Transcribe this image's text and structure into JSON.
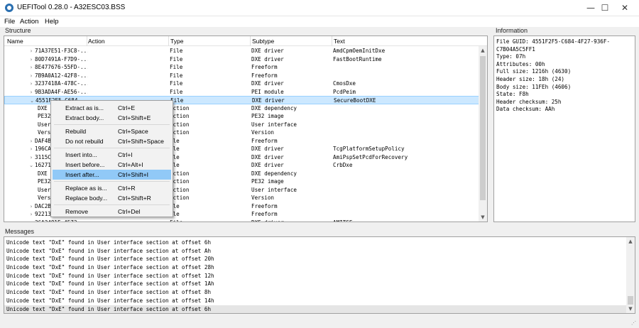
{
  "window": {
    "title": "UEFITool 0.28.0 - A32ESC03.BSS",
    "minimize": "—",
    "maximize": "☐",
    "close": "✕"
  },
  "menu": [
    "File",
    "Action",
    "Help"
  ],
  "structure": {
    "label": "Structure",
    "columns": [
      "Name",
      "Action",
      "Type",
      "Subtype",
      "Text"
    ],
    "rows": [
      {
        "arrow": "›",
        "name": "71A37E51-F3C8-...",
        "type": "File",
        "subtype": "DXE driver",
        "text": "AmdCpmOemInitDxe"
      },
      {
        "arrow": "›",
        "name": "80D7491A-F7D9-...",
        "type": "File",
        "subtype": "DXE driver",
        "text": "FastBootRuntime"
      },
      {
        "arrow": "›",
        "name": "8E477676-55FD-...",
        "type": "File",
        "subtype": "Freeform",
        "text": ""
      },
      {
        "arrow": "›",
        "name": "7B9A0A12-42F8-...",
        "type": "File",
        "subtype": "Freeform",
        "text": ""
      },
      {
        "arrow": "›",
        "name": "3237418A-478C-...",
        "type": "File",
        "subtype": "DXE driver",
        "text": "CmosDxe"
      },
      {
        "arrow": "›",
        "name": "9B3ADA4F-AE56-...",
        "type": "File",
        "subtype": "PEI module",
        "text": "PcdPeim"
      },
      {
        "arrow": "⌄",
        "name": "4551F2F5-C684-...",
        "type": "File",
        "subtype": "DXE driver",
        "text": "SecureBootDXE"
      },
      {
        "arrow": "",
        "name": "DXE",
        "type": "ection",
        "subtype": "DXE dependency",
        "text": ""
      },
      {
        "arrow": "",
        "name": "PE32",
        "type": "ection",
        "subtype": "PE32 image",
        "text": ""
      },
      {
        "arrow": "",
        "name": "User",
        "type": "ection",
        "subtype": "User interface",
        "text": ""
      },
      {
        "arrow": "",
        "name": "Vers",
        "type": "ection",
        "subtype": "Version",
        "text": ""
      },
      {
        "arrow": "›",
        "name": "DAF4B",
        "type": "ile",
        "subtype": "Freeform",
        "text": ""
      },
      {
        "arrow": "›",
        "name": "196CA",
        "type": "ile",
        "subtype": "DXE driver",
        "text": "TcgPlatformSetupPolicy"
      },
      {
        "arrow": "›",
        "name": "3115C",
        "type": "ile",
        "subtype": "DXE driver",
        "text": "AmiPspSetPcdForRecovery"
      },
      {
        "arrow": "⌄",
        "name": "16271",
        "type": "ile",
        "subtype": "DXE driver",
        "text": "CrbDxe"
      },
      {
        "arrow": "",
        "name": "DXE",
        "type": "ection",
        "subtype": "DXE dependency",
        "text": ""
      },
      {
        "arrow": "",
        "name": "PE32",
        "type": "ection",
        "subtype": "PE32 image",
        "text": ""
      },
      {
        "arrow": "",
        "name": "User",
        "type": "ection",
        "subtype": "User interface",
        "text": ""
      },
      {
        "arrow": "",
        "name": "Vers",
        "type": "ection",
        "subtype": "Version",
        "text": ""
      },
      {
        "arrow": "›",
        "name": "DAC2B",
        "type": "ile",
        "subtype": "Freeform",
        "text": ""
      },
      {
        "arrow": "›",
        "name": "92213",
        "type": "ile",
        "subtype": "Freeform",
        "text": ""
      },
      {
        "arrow": "›",
        "name": "26A2481E-4573-...",
        "type": "File",
        "subtype": "DXE driver",
        "text": "AMITSE"
      }
    ]
  },
  "information": {
    "label": "Information",
    "lines": [
      "File GUID: 4551F2F5-C684-4F27-936F-",
      "C7B04A5C5FF1",
      "Type: 07h",
      "Attributes: 00h",
      "Full size: 1216h (4630)",
      "Header size: 18h (24)",
      "Body size: 11FEh (4606)",
      "State: F8h",
      "Header checksum: 25h",
      "Data checksum: AAh"
    ]
  },
  "messages": {
    "label": "Messages",
    "rows": [
      "Unicode text \"DxE\" found in User interface section at offset 6h",
      "Unicode text \"DxE\" found in User interface section at offset Ah",
      "Unicode text \"DxE\" found in User interface section at offset 20h",
      "Unicode text \"DxE\" found in User interface section at offset 28h",
      "Unicode text \"DxE\" found in User interface section at offset 12h",
      "Unicode text \"DxE\" found in User interface section at offset 1Ah",
      "Unicode text \"DxE\" found in User interface section at offset 8h",
      "Unicode text \"DxE\" found in User interface section at offset 14h",
      "Unicode text \"DxE\" found in User interface section at offset 6h"
    ]
  },
  "context_menu": {
    "items": [
      {
        "label": "Extract as is...",
        "shortcut": "Ctrl+E"
      },
      {
        "label": "Extract body...",
        "shortcut": "Ctrl+Shift+E"
      },
      {
        "sep": true
      },
      {
        "label": "Rebuild",
        "shortcut": "Ctrl+Space"
      },
      {
        "label": "Do not rebuild",
        "shortcut": "Ctrl+Shift+Space"
      },
      {
        "sep": true
      },
      {
        "label": "Insert into...",
        "shortcut": "Ctrl+I"
      },
      {
        "label": "Insert before...",
        "shortcut": "Ctrl+Alt+I"
      },
      {
        "label": "Insert after...",
        "shortcut": "Ctrl+Shift+I",
        "highlighted": true
      },
      {
        "sep": true
      },
      {
        "label": "Replace as is...",
        "shortcut": "Ctrl+R"
      },
      {
        "label": "Replace body...",
        "shortcut": "Ctrl+Shift+R"
      },
      {
        "sep": true
      },
      {
        "label": "Remove",
        "shortcut": "Ctrl+Del"
      }
    ]
  },
  "colors": {
    "selection": "#cce8ff",
    "menu_highlight": "#91c9f7",
    "accent": "#2a6fb0"
  }
}
